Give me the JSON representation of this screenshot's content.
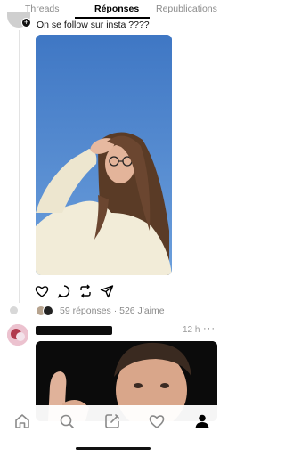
{
  "tabs": [
    {
      "label": "Threads",
      "active": false
    },
    {
      "label": "Réponses",
      "active": true
    },
    {
      "label": "Republications",
      "active": false
    }
  ],
  "reply_context": {
    "text": "On se follow sur insta ????"
  },
  "post": {
    "image_icon": "photo",
    "actions": [
      "heart-icon",
      "comment-icon",
      "repost-icon",
      "share-icon"
    ],
    "stats": "59 réponses · 526 J'aime"
  },
  "next_post": {
    "time": "12 h",
    "more": "···"
  },
  "bottom_nav": [
    "home-icon",
    "search-icon",
    "compose-icon",
    "activity-icon",
    "profile-icon"
  ],
  "colors": {
    "accent": "#000000",
    "muted": "#8a8a8a",
    "sky": "#4a80c9"
  }
}
